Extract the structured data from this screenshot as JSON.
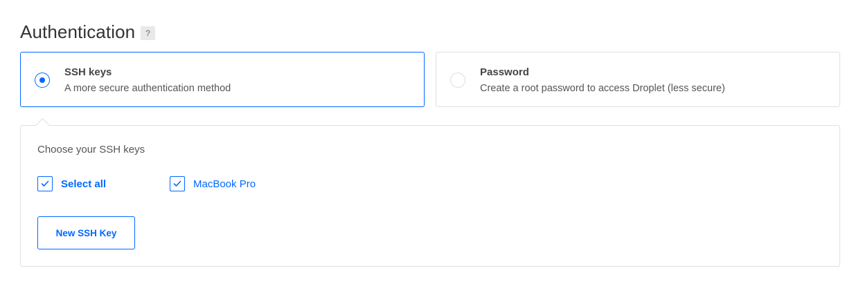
{
  "heading": {
    "title": "Authentication",
    "help_badge": "?"
  },
  "auth_options": {
    "ssh": {
      "title": "SSH keys",
      "description": "A more secure authentication method",
      "selected": true
    },
    "password": {
      "title": "Password",
      "description": "Create a root password to access Droplet (less secure)",
      "selected": false
    }
  },
  "ssh_panel": {
    "label": "Choose your SSH keys",
    "select_all": {
      "label": "Select all",
      "checked": true
    },
    "keys": [
      {
        "label": "MacBook Pro",
        "checked": true
      }
    ],
    "new_key_button": "New SSH Key"
  },
  "colors": {
    "accent": "#0069ff",
    "border": "#dfdfdf",
    "text": "#333333",
    "help_badge_bg": "#e9e9e9"
  },
  "icons": {
    "checkbox_checked": "checkmark-icon",
    "radio_selected": "radio-selected-icon",
    "radio_unselected": "radio-unselected-icon"
  }
}
